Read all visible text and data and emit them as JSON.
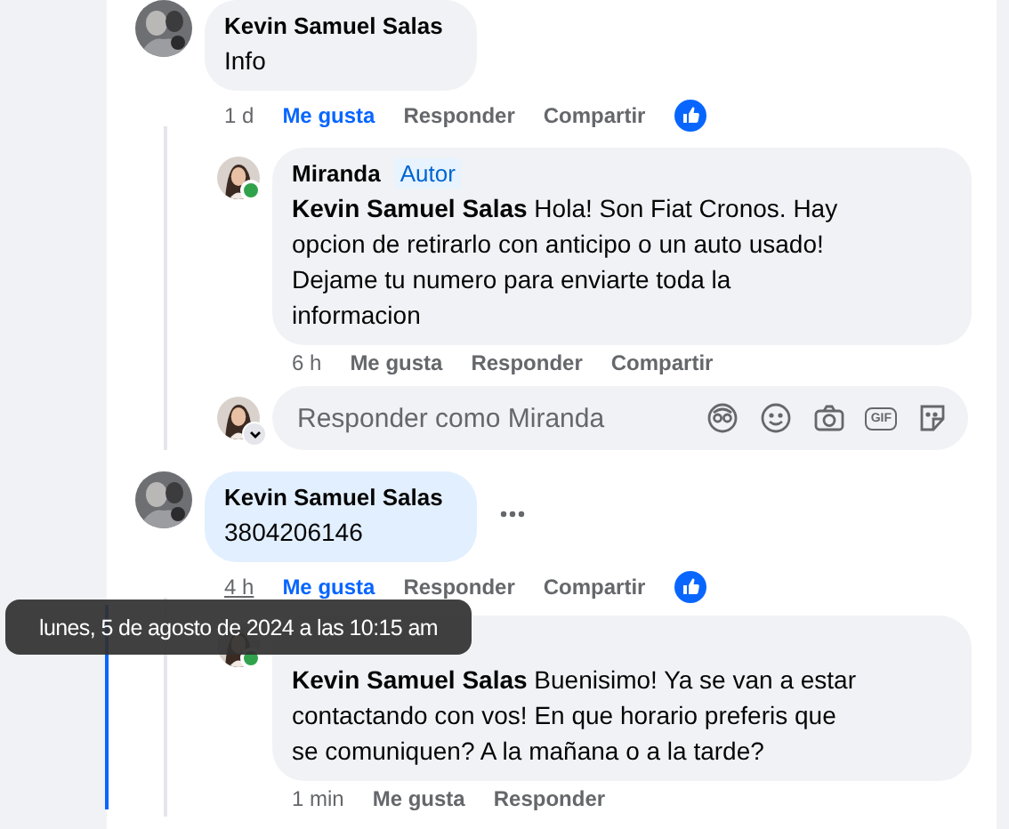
{
  "comments": [
    {
      "author": "Kevin Samuel Salas",
      "text": "Info",
      "highlighted": false,
      "menu": false,
      "time": "1 d",
      "time_hovered": false,
      "liked": true,
      "reaction": true,
      "actions": [
        "Me gusta",
        "Responder",
        "Compartir"
      ],
      "replies": [
        {
          "author": "Miranda",
          "badge": "Autor",
          "online": true,
          "mention": "Kevin Samuel Salas",
          "text": "Hola! Son Fiat Cronos. Hay opcion de retirarlo con anticipo o un auto usado! Dejame tu numero para enviarte toda la informacion",
          "time": "6 h",
          "liked": false,
          "actions": [
            "Me gusta",
            "Responder",
            "Compartir"
          ]
        }
      ],
      "reply_box": {
        "placeholder": "Responder como Miranda",
        "gif": "GIF"
      }
    },
    {
      "author": "Kevin Samuel Salas",
      "text": "3804206146",
      "highlighted": true,
      "menu": true,
      "time": "4 h",
      "time_hovered": true,
      "liked": true,
      "reaction": true,
      "actions": [
        "Me gusta",
        "Responder",
        "Compartir"
      ],
      "replies": [
        {
          "online": true,
          "mention": "Kevin Samuel Salas",
          "text": "Buenisimo! Ya se van a estar contactando con vos! En que horario preferis que se comuniquen? A la mañana o a la tarde?",
          "time": "1 min",
          "liked": false,
          "actions": [
            "Me gusta",
            "Responder"
          ]
        }
      ]
    }
  ],
  "tooltip": {
    "text": "lunes, 5 de agosto de 2024 a las 10:15 am"
  }
}
